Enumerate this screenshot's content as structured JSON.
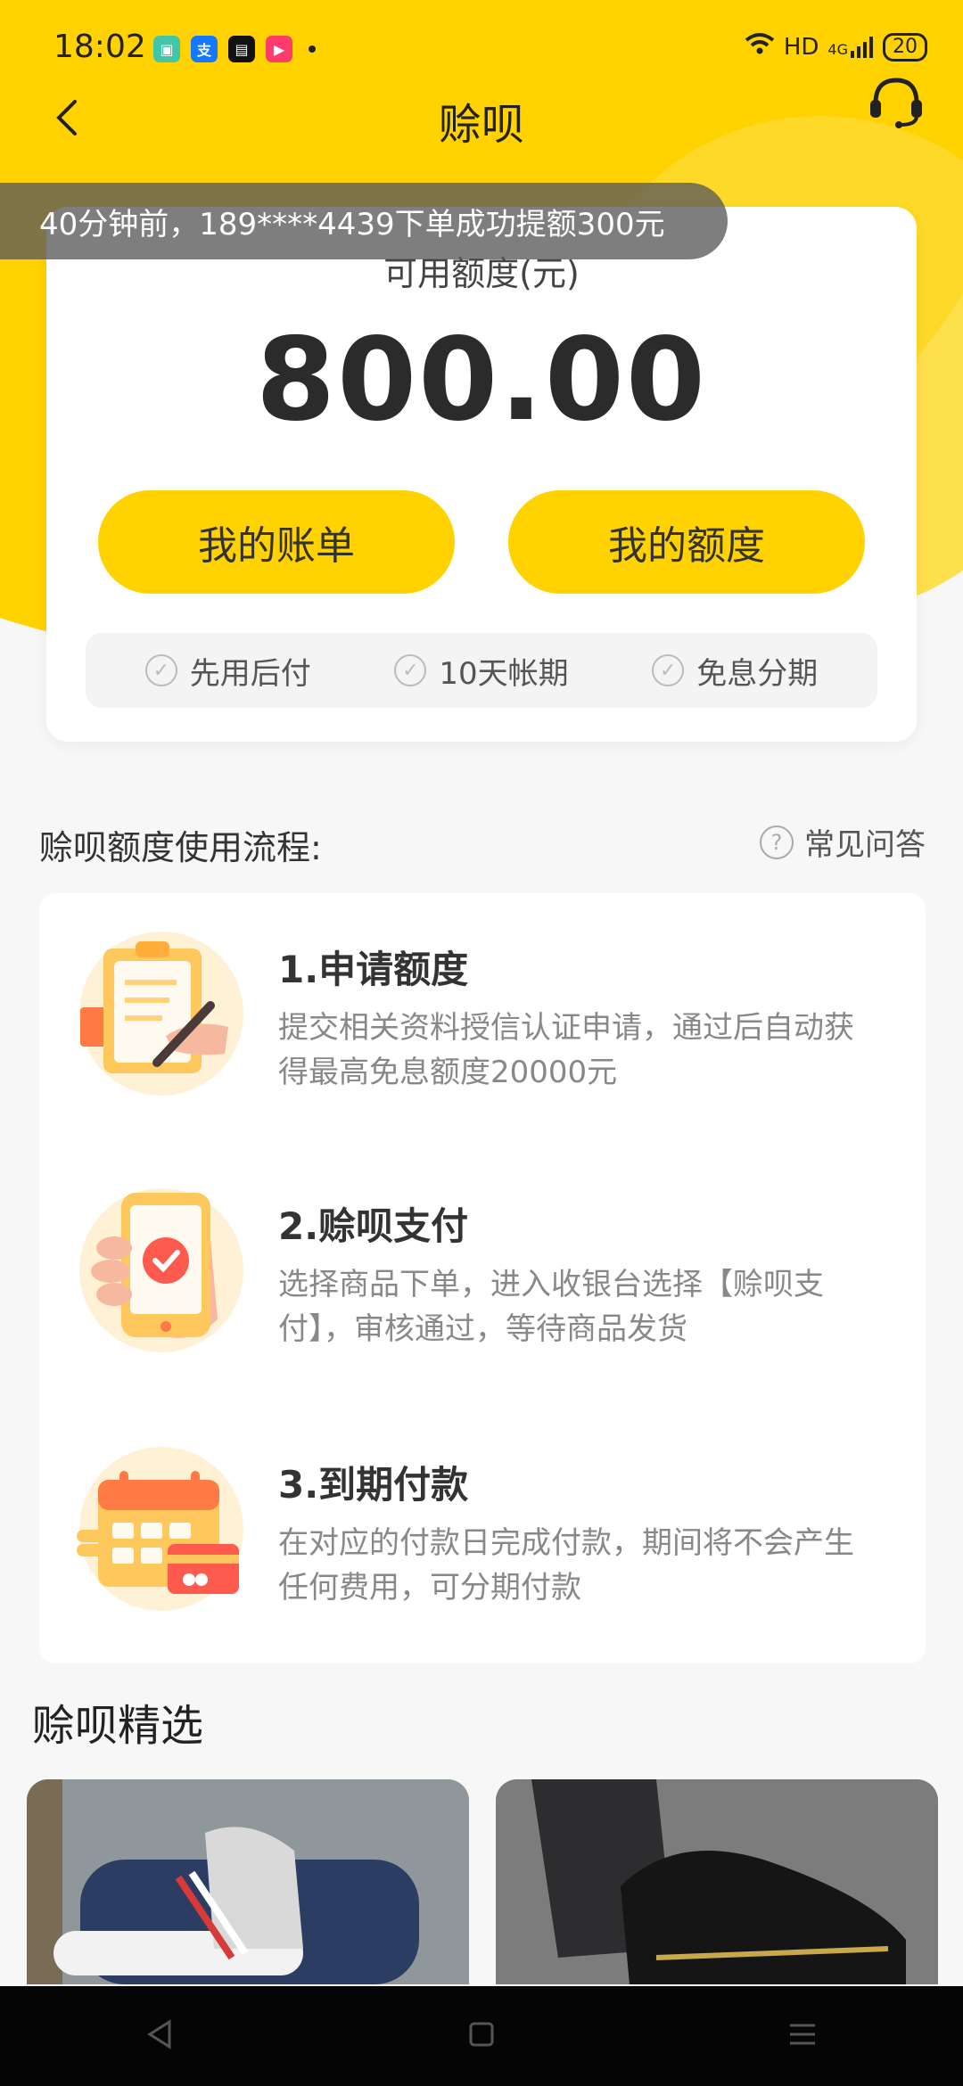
{
  "status_bar": {
    "time": "18:02",
    "network_label": "HD",
    "signal_label": "4G",
    "battery": "20"
  },
  "nav": {
    "title": "赊呗"
  },
  "notice": {
    "text": "40分钟前，189****4439下单成功提额300元"
  },
  "credit": {
    "label": "可用额度(元)",
    "amount": "800.00",
    "buttons": {
      "bill": "我的账单",
      "limit": "我的额度"
    },
    "features": [
      {
        "label": "先用后付"
      },
      {
        "label": "10天帐期"
      },
      {
        "label": "免息分期"
      }
    ]
  },
  "process": {
    "title": "赊呗额度使用流程:",
    "faq_label": "常见问答",
    "steps": [
      {
        "title": "1.申请额度",
        "desc": "提交相关资料授信认证申请，通过后自动获得最高免息额度20000元"
      },
      {
        "title": "2.赊呗支付",
        "desc": "选择商品下单，进入收银台选择【赊呗支付】，审核通过，等待商品发货"
      },
      {
        "title": "3.到期付款",
        "desc": "在对应的付款日完成付款，期间将不会产生任何费用，可分期付款"
      }
    ]
  },
  "picks": {
    "title": "赊呗精选"
  },
  "colors": {
    "accent": "#ffd200",
    "button": "#ffd200",
    "text_primary": "#333333",
    "text_secondary": "#888888"
  },
  "icons": {
    "back": "chevron-left-icon",
    "support": "headset-icon",
    "check": "check-circle-icon",
    "help": "question-circle-icon"
  }
}
